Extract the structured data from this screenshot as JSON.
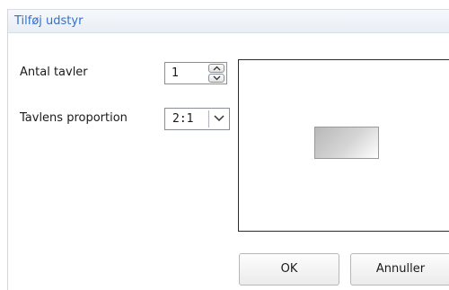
{
  "dialog": {
    "title": "Tilføj udstyr",
    "labels": {
      "board_count": "Antal tavler",
      "board_proportion": "Tavlens proportion"
    },
    "board_count_value": "1",
    "board_proportion_value": "2:1",
    "buttons": {
      "ok": "OK",
      "cancel": "Annuller"
    }
  },
  "colors": {
    "title_text": "#3470c4",
    "preview_border": "#2a2a2a"
  },
  "icons": [
    "chevron-up-icon",
    "chevron-down-icon"
  ]
}
